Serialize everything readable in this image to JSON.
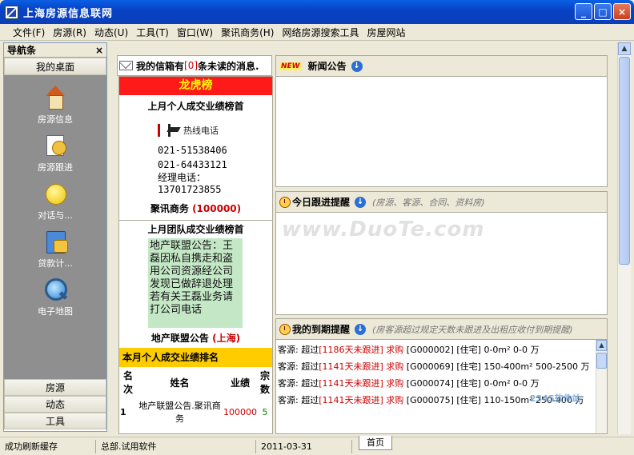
{
  "window": {
    "title": "上海房源信息联网",
    "btn_min": "_",
    "btn_max": "□",
    "btn_close": "×"
  },
  "menu": [
    "文件(F)",
    "房源(R)",
    "动态(U)",
    "工具(T)",
    "窗口(W)",
    "聚讯商务(H)",
    "网络房源搜索工具",
    "房屋网站"
  ],
  "nav": {
    "title": "导航条",
    "close": "×",
    "top_section": "我的桌面",
    "tools": [
      {
        "label": "房源信息",
        "icon": "house-icon"
      },
      {
        "label": "房源跟进",
        "icon": "follow-icon"
      },
      {
        "label": "对话与...",
        "icon": "smile-icon"
      },
      {
        "label": "贷款计...",
        "icon": "calc-icon"
      },
      {
        "label": "电子地图",
        "icon": "map-icon"
      }
    ],
    "bottom_sections": [
      "房源",
      "动态",
      "工具"
    ]
  },
  "inbox": {
    "prefix": "我的信箱有",
    "count": "[0]",
    "suffix": "条未读的消息."
  },
  "ranking": {
    "title": "龙虎榜",
    "personal_title": "上月个人成交业绩榜首",
    "hotline_label": "热线电话",
    "phone1": "021-51538406",
    "phone2": "021-64433121",
    "manager_label": "经理电话：",
    "manager_phone": "13701723855",
    "biz_name": "聚讯商务",
    "biz_value": "(100000)",
    "team_title": "上月团队成交业绩榜首",
    "notice": "地产联盟公告：王磊因私自携走和盗用公司资源经公司发现已做辞退处理 若有关王磊业务请打公司电话",
    "league_name": "地产联盟公告",
    "league_city": "(上海)",
    "monthly_title": "本月个人成交业绩排名",
    "table": {
      "headers": [
        "名次",
        "姓名",
        "业绩",
        "宗数"
      ],
      "rows": [
        [
          "1",
          "地产联盟公告.聚讯商务",
          "100000",
          "5"
        ]
      ]
    }
  },
  "news": {
    "badge": "NEW",
    "title": "新闻公告"
  },
  "today": {
    "title": "今日跟进提醒",
    "hint": "(房源、客源、合同、资料房)"
  },
  "expiry": {
    "title": "我的到期提醒",
    "hint": "(房客源超过规定天数未跟进及出租应收付到期提醒)",
    "rows": [
      {
        "a": "客源: 超过",
        "b": "[1186天未跟进]",
        "c": "求购",
        "d": " [G000002] [住宅] 0-0m² 0-0 万"
      },
      {
        "a": "客源: 超过",
        "b": "[1141天未跟进]",
        "c": "求购",
        "d": " [G000069] [住宅] 150-400m² 500-2500 万"
      },
      {
        "a": "客源: 超过",
        "b": "[1141天未跟进]",
        "c": "求购",
        "d": " [G000074] [住宅] 0-0m² 0-0 万"
      },
      {
        "a": "客源: 超过",
        "b": "[1141天未跟进]",
        "c": "求购",
        "d": " [G000075] [住宅] 110-150m² 250-400 万"
      }
    ]
  },
  "status": {
    "msg": "成功刷新缓存",
    "org": "总部.试用软件",
    "date": "2011-03-31",
    "tab": "首页"
  },
  "watermark": "www.DuoTe.com",
  "corner_mark": "2345软件站"
}
